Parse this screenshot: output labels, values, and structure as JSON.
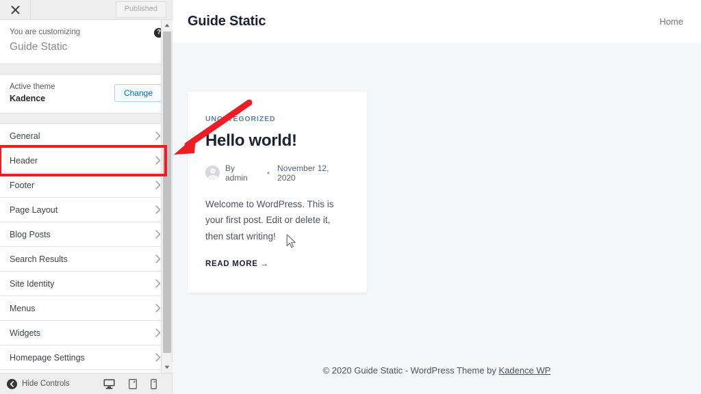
{
  "customizer": {
    "topbar": {
      "close_icon": "close-icon",
      "publish_label": "Published"
    },
    "intro": {
      "eyebrow": "You are customizing",
      "site_name": "Guide Static",
      "help_icon": "help-icon",
      "help_glyph": "?"
    },
    "theme": {
      "label": "Active theme",
      "name": "Kadence",
      "change_label": "Change"
    },
    "sections": [
      {
        "label": "General"
      },
      {
        "label": "Header"
      },
      {
        "label": "Footer"
      },
      {
        "label": "Page Layout"
      },
      {
        "label": "Blog Posts"
      },
      {
        "label": "Search Results"
      },
      {
        "label": "Site Identity"
      },
      {
        "label": "Menus"
      },
      {
        "label": "Widgets"
      },
      {
        "label": "Homepage Settings"
      }
    ],
    "bottombar": {
      "hide_controls_label": "Hide Controls",
      "devices": [
        {
          "name": "desktop",
          "active": true
        },
        {
          "name": "tablet",
          "active": false
        },
        {
          "name": "mobile",
          "active": false
        }
      ]
    }
  },
  "preview": {
    "header": {
      "brand": "Guide Static",
      "nav": [
        {
          "label": "Home"
        }
      ]
    },
    "post": {
      "category": "UNCATEGORIZED",
      "title": "Hello world!",
      "author": "By admin",
      "separator": "•",
      "date": "November 12, 2020",
      "excerpt": "Welcome to WordPress. This is your first post. Edit or delete it, then start writing!",
      "read_more": "READ MORE",
      "read_more_arrow": "→"
    },
    "footer": {
      "text_before": "© 2020 Guide Static - WordPress Theme by ",
      "link_label": "Kadence WP"
    }
  },
  "annotations": {
    "highlight_color": "#ee1c25",
    "arrow_color": "#ee1c25"
  }
}
